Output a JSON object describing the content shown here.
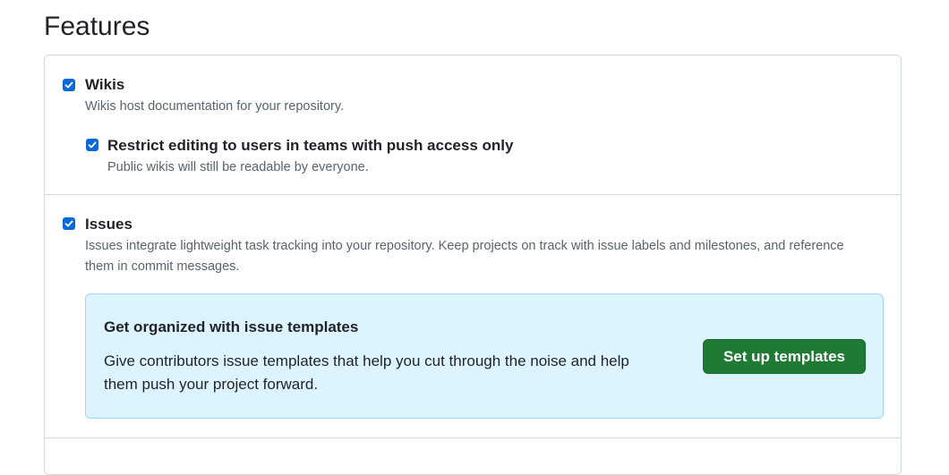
{
  "page": {
    "title": "Features"
  },
  "features": {
    "wikis": {
      "label": "Wikis",
      "checked": true,
      "description": "Wikis host documentation for your repository.",
      "restrict": {
        "label": "Restrict editing to users in teams with push access only",
        "checked": true,
        "description": "Public wikis will still be readable by everyone."
      }
    },
    "issues": {
      "label": "Issues",
      "checked": true,
      "description": "Issues integrate lightweight task tracking into your repository. Keep projects on track with issue labels and milestones, and reference them in commit messages.",
      "promo": {
        "title": "Get organized with issue templates",
        "text": "Give contributors issue templates that help you cut through the noise and help them push your project forward.",
        "button_label": "Set up templates"
      }
    }
  },
  "colors": {
    "checkbox": "#0969da",
    "primary_button": "#1f7a34",
    "promo_background": "#ddf4ff",
    "border": "#d0d7de"
  },
  "icons": {
    "checkbox_mark": "check-icon"
  }
}
